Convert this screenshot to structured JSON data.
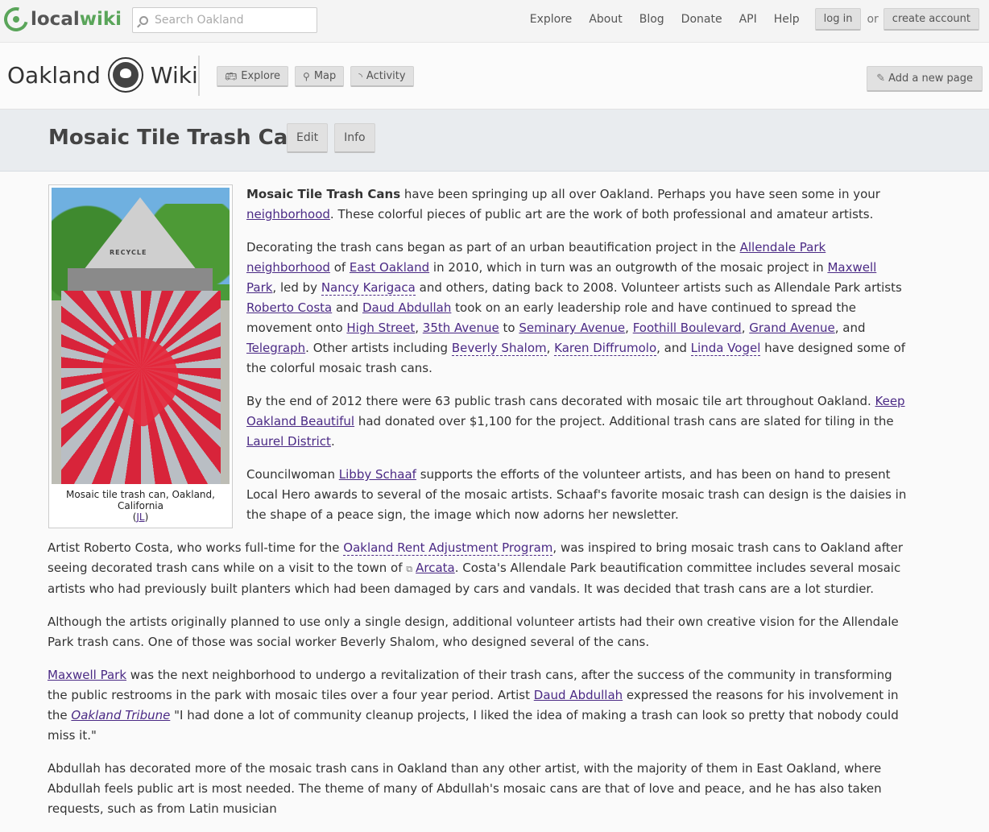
{
  "brand": {
    "logo_part1": "local",
    "logo_part2": "wiki"
  },
  "search": {
    "placeholder": "Search Oakland"
  },
  "topnav": {
    "items": [
      "Explore",
      "About",
      "Blog",
      "Donate",
      "API",
      "Help"
    ],
    "login": "log in",
    "or": "or",
    "create": "create account"
  },
  "site": {
    "name_left": "Oakland",
    "name_right": "Wiki",
    "tabs": [
      "Explore",
      "Map",
      "Activity"
    ],
    "add_page": "Add a new page"
  },
  "page": {
    "title": "Mosaic Tile Trash Cans",
    "tabs": [
      "Edit",
      "Info"
    ]
  },
  "figure": {
    "lid_text": "RECYCLE",
    "caption": "Mosaic tile trash can, Oakland, California",
    "credit": "JL"
  },
  "article": {
    "p1": {
      "bold": "Mosaic Tile Trash Cans",
      "t1": " have been springing up all over Oakland. Perhaps you have seen some in your ",
      "l1": "neighborhood",
      "t2": ". These colorful pieces of public art are the work of both professional and amateur artists."
    },
    "p2": {
      "t1": "Decorating the trash cans began as part of an urban beautification project in the ",
      "l1": "Allendale Park",
      "t2": " ",
      "l2": "neighborhood",
      "t3": " of ",
      "l3": "East Oakland",
      "t4": " in 2010, which in turn was an outgrowth of the mosaic project in ",
      "l4": "Maxwell Park",
      "t5": ", led by ",
      "l5": "Nancy Karigaca",
      "t6": " and others, dating back to 2008. Volunteer artists such as Allendale Park artists ",
      "l6": "Roberto Costa",
      "t7": " and ",
      "l7": "Daud Abdullah",
      "t8": " took on an early leadership role and have continued to spread the movement onto ",
      "l8": "High Street",
      "t9": ", ",
      "l9": "35th Avenue",
      "t10": " to ",
      "l10": "Seminary Avenue",
      "t11": ", ",
      "l11": "Foothill Boulevard",
      "t12": ", ",
      "l12": "Grand Avenue",
      "t13": ", and ",
      "l13": "Telegraph",
      "t14": ". Other artists including ",
      "l14": "Beverly Shalom",
      "t15": ", ",
      "l15": "Karen Diffrumolo",
      "t16": ", and ",
      "l16": "Linda Vogel",
      "t17": " have designed some of the colorful mosaic trash cans."
    },
    "p3": {
      "t1": "By the end of 2012 there were 63 public trash cans decorated with mosaic tile art throughout Oakland. ",
      "l1": "Keep Oakland Beautiful",
      "t2": " had donated over $1,100 for the project. Additional trash cans are slated for tiling in the ",
      "l2": "Laurel District",
      "t3": "."
    },
    "p4": {
      "t1": "Councilwoman ",
      "l1": "Libby Schaaf",
      "t2": " supports the efforts of the volunteer artists, and has been on hand to present Local Hero awards to several of the mosaic artists. Schaaf's favorite mosaic trash can design is the daisies in the shape of a peace sign, the image which now adorns her newsletter."
    },
    "p5": {
      "t1": "Artist Roberto Costa, who works full-time for the ",
      "l1": "Oakland Rent Adjustment Program",
      "t2": ", was inspired to bring mosaic trash cans to Oakland after seeing decorated trash cans while on a visit to the town of ",
      "l2": "Arcata",
      "t3": ". Costa's Allendale Park beautification committee includes several mosaic artists who had previously built planters which had been damaged by cars and vandals. It was decided that trash cans are a lot sturdier."
    },
    "p6": {
      "t1": "Although the artists originally planned to use only a single design, additional volunteer artists had their own creative vision for the Allendale Park trash cans. One of those was social worker Beverly Shalom, who designed several of the cans."
    },
    "p7": {
      "l1": "Maxwell Park",
      "t1": " was the next neighborhood to undergo a revitalization of their trash cans, after the success of the community in transforming the public restrooms in the park with mosaic tiles over a four year period. Artist ",
      "l2": "Daud Abdullah",
      "t2": " expressed the reasons for his involvement in the ",
      "l3": "Oakland Tribune",
      "t3": " \"I had done a lot of community cleanup projects, I liked the idea of making a trash can look so pretty that nobody could miss it.\""
    },
    "p8": {
      "t1": "Abdullah has decorated more of the mosaic trash cans in Oakland than any other artist, with the majority of them in East Oakland, where Abdullah feels public art is most needed. The theme of many of Abdullah's mosaic cans are that of love and peace, and he has also taken requests, such as from Latin musician"
    }
  }
}
